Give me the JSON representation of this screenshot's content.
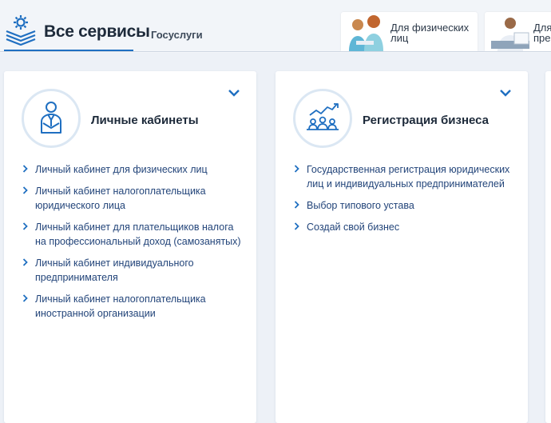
{
  "header": {
    "tab_all_services": "Все сервисы",
    "tab_gosuslugi": "Госуслуги",
    "audience": [
      {
        "label": "Для физических\nлиц"
      },
      {
        "label": "Для\nпре"
      }
    ],
    "colors": {
      "accent": "#1f6fc1",
      "link": "#23457a",
      "title": "#1d2a3a"
    }
  },
  "sections": [
    {
      "title": "Личные кабинеты",
      "icon": "person-tie-icon",
      "links": [
        "Личный кабинет для физических лиц",
        "Личный кабинет налогоплательщика юридического лица",
        "Личный кабинет для плательщиков налога на профессиональный доход (самозанятых)",
        "Личный кабинет индивидуального предпринимателя",
        "Личный кабинет налогоплательщика иностранной организации"
      ]
    },
    {
      "title": "Регистрация бизнеса",
      "icon": "business-growth-icon",
      "links": [
        "Государственная регистрация юридических лиц и индивидуальных предпринимателей",
        "Выбор типового устава",
        "Создай свой бизнес"
      ]
    }
  ]
}
